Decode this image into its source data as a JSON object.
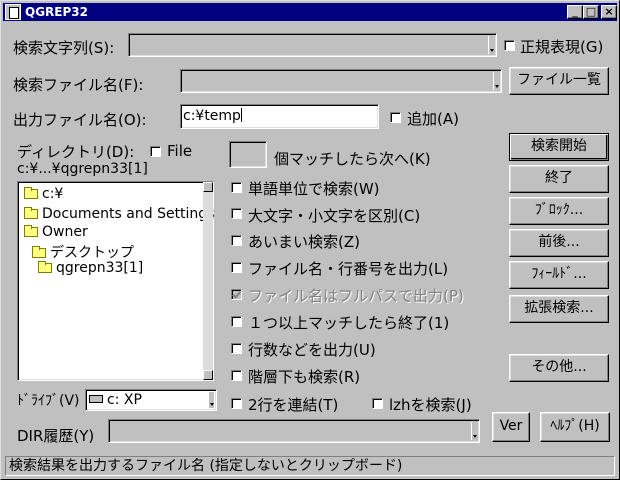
{
  "window": {
    "title": "QGREP32"
  },
  "titlebar_buttons": {
    "minimize": "_",
    "maximize": "□",
    "close": "×"
  },
  "search": {
    "label": "検索文字列(S):",
    "value": ""
  },
  "regex": {
    "label": "正規表現(G)",
    "checked": false
  },
  "file_name": {
    "label": "検索ファイル名(F):",
    "value": ""
  },
  "file_list_button": "ファイル一覧",
  "output": {
    "label": "出力ファイル名(O):",
    "value": "c:¥temp"
  },
  "append": {
    "label": "追加(A)",
    "checked": false
  },
  "directory": {
    "label": "ディレクトリ(D):",
    "file_label": "File",
    "file_checked": false,
    "path": "c:¥...¥qgrepn33[1]",
    "tree": [
      {
        "name": "c:¥",
        "level": 0
      },
      {
        "name": "Documents and Settings",
        "level": 1
      },
      {
        "name": "Owner",
        "level": 1
      },
      {
        "name": "デスクトップ",
        "level": 2
      },
      {
        "name": "qgrepn33[1]",
        "level": 3
      }
    ]
  },
  "match_count": {
    "value": "",
    "label": "個マッチしたら次へ(K)"
  },
  "options": [
    {
      "label": "単語単位で検索(W)",
      "checked": false,
      "disabled": false
    },
    {
      "label": "大文字・小文字を区別(C)",
      "checked": false,
      "disabled": false
    },
    {
      "label": "あいまい検索(Z)",
      "checked": false,
      "disabled": false
    },
    {
      "label": "ファイル名・行番号を出力(L)",
      "checked": false,
      "disabled": false
    },
    {
      "label": "ファイル名はフルパスで出力(P)",
      "checked": true,
      "disabled": true
    },
    {
      "label": "１つ以上マッチしたら終了(1)",
      "checked": false,
      "disabled": false
    },
    {
      "label": "行数などを出力(U)",
      "checked": false,
      "disabled": false
    },
    {
      "label": "階層下も検索(R)",
      "checked": false,
      "disabled": false
    },
    {
      "label": "2行を連結(T)",
      "checked": false,
      "disabled": false
    }
  ],
  "lzh": {
    "label": "lzhを検索(J)",
    "checked": false
  },
  "buttons": {
    "start": "検索開始",
    "quit": "終了",
    "block": "ﾌﾞﾛｯｸ...",
    "before_after": "前後...",
    "field": "ﾌｨｰﾙﾄﾞ...",
    "extended": "拡張検索...",
    "other": "その他...",
    "ver": "Ver",
    "help": "ﾍﾙﾌﾟ(H)"
  },
  "drive": {
    "label": "ﾄﾞﾗｲﾌﾞ(V)",
    "value": "c: XP"
  },
  "dir_history": {
    "label": "DIR履歴(Y)",
    "value": ""
  },
  "status_bar": "検索結果を出力するファイル名 (指定しないとクリップボード)"
}
